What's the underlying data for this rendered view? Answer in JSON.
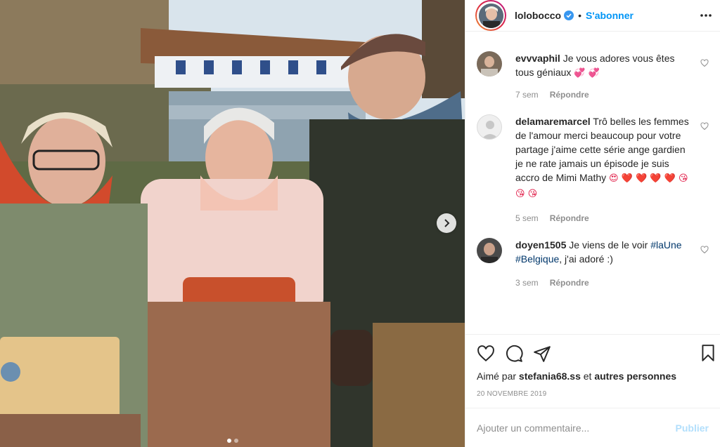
{
  "header": {
    "username": "lolobocco",
    "separator": "•",
    "follow_label": "S'abonner"
  },
  "comments": [
    {
      "user": "evvvaphil",
      "text": "Je vous adores vous êtes tous géniaux",
      "emojis": "💞 💞",
      "time": "7 sem",
      "reply": "Répondre"
    },
    {
      "user": "delamaremarcel",
      "text": "Trô belles les femmes de l'amour merci beaucoup pour votre partage j'aime cette série ange gardien je ne rate jamais un épisode je suis accro de Mimi Mathy",
      "emojis": "😍 ❤️ ❤️ ❤️ ❤️ 😘 😘 😘",
      "time": "5 sem",
      "reply": "Répondre"
    },
    {
      "user": "doyen1505",
      "text_before": "Je viens de le voir",
      "tag1": "#laUne",
      "tag2": "#Belgique",
      "text_after": ", j'ai adoré :)",
      "time": "3 sem",
      "reply": "Répondre"
    }
  ],
  "likes": {
    "prefix": "Aimé par",
    "user": "stefania68.ss",
    "middle": "et",
    "others": "autres personnes"
  },
  "date": "20 NOVEMBRE 2019",
  "add_comment": {
    "placeholder": "Ajouter un commentaire...",
    "publish_label": "Publier"
  },
  "carousel": {
    "current_slide": 1,
    "total_slides": 2
  },
  "colors": {
    "accent": "#0095f6",
    "text": "#262626",
    "muted": "#8e8e8e",
    "publish_disabled": "#b2dffc"
  },
  "icons": [
    "verified-badge-icon",
    "more-options-icon",
    "heart-icon",
    "comment-icon",
    "share-icon",
    "bookmark-icon",
    "chevron-right-icon"
  ]
}
